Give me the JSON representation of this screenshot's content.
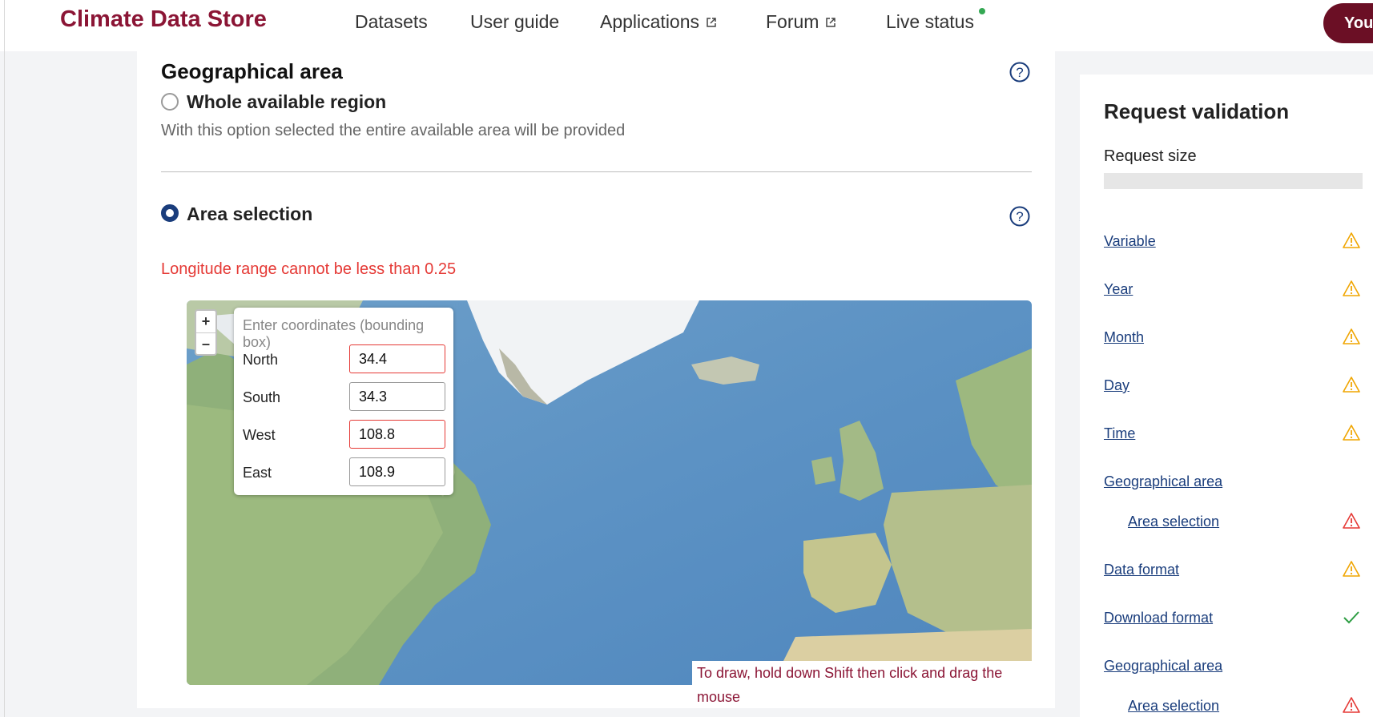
{
  "header": {
    "brand": "Climate Data Store",
    "nav": [
      "Datasets",
      "User guide",
      "Applications",
      "Forum",
      "Live status"
    ],
    "account_label": "You"
  },
  "geo": {
    "title": "Geographical area",
    "whole_label": "Whole available region",
    "whole_desc": "With this option selected the entire available area will be provided",
    "area_label": "Area selection",
    "selected_option": "Area selection",
    "error": "Longitude range cannot be less than 0.25"
  },
  "map": {
    "zoom_in": "+",
    "zoom_out": "–",
    "coords_title": "Enter coordinates (bounding box)",
    "fields": [
      {
        "label": "North",
        "value": "34.4",
        "invalid": true
      },
      {
        "label": "South",
        "value": "34.3",
        "invalid": false
      },
      {
        "label": "West",
        "value": "108.8",
        "invalid": true
      },
      {
        "label": "East",
        "value": "108.9",
        "invalid": false
      }
    ],
    "hint": "To draw, hold down Shift then click and drag the mouse"
  },
  "validation": {
    "title": "Request validation",
    "size_label": "Request size",
    "items": [
      {
        "label": "Variable",
        "status": "warning"
      },
      {
        "label": "Year",
        "status": "warning"
      },
      {
        "label": "Month",
        "status": "warning"
      },
      {
        "label": "Day",
        "status": "warning"
      },
      {
        "label": "Time",
        "status": "warning"
      },
      {
        "label": "Geographical area",
        "status": "none"
      },
      {
        "label": "Area selection",
        "status": "error"
      },
      {
        "label": "Data format",
        "status": "warning"
      },
      {
        "label": "Download format",
        "status": "ok"
      },
      {
        "label": "Geographical area",
        "status": "none"
      },
      {
        "label": "Area selection",
        "status": "error"
      }
    ]
  },
  "colors": {
    "brand": "#8b1535",
    "link": "#1a3d7c",
    "error": "#e53935",
    "warning": "#f0a500",
    "ok": "#2e9e44"
  }
}
